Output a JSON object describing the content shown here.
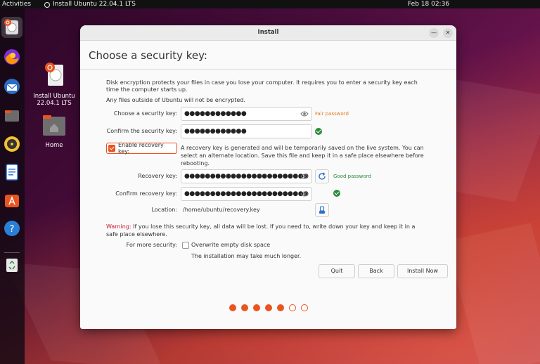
{
  "topbar": {
    "activities": "Activities",
    "app_name": "Install Ubuntu 22.04.1 LTS",
    "clock": "Feb 18  02:36"
  },
  "dock": {
    "items": [
      "ubuntu-installer-icon",
      "firefox-icon",
      "thunderbird-icon",
      "files-icon",
      "rhythmbox-icon",
      "writer-icon",
      "app-center-icon",
      "help-icon",
      "trash-icon"
    ]
  },
  "desktop": {
    "installer_label": "Install Ubuntu 22.04.1 LTS",
    "home_label": "Home"
  },
  "window": {
    "title": "Install",
    "heading": "Choose a security key:",
    "intro_line1": "Disk encryption protects your files in case you lose your computer. It requires you to enter a security key each",
    "intro_line2": "time the computer starts up.",
    "intro_line3": "Any files outside of Ubuntu will not be encrypted.",
    "security_key": {
      "label": "Choose a security key:",
      "value": "●●●●●●●●●●●●",
      "strength": "Fair password"
    },
    "confirm_key": {
      "label": "Confirm the security key:",
      "value": "●●●●●●●●●●●●"
    },
    "recovery_checkbox": {
      "label": "Enable recovery key:",
      "checked": true,
      "desc_line1": "A recovery key is generated and will be temporarily saved on the live system. You can",
      "desc_line2": "select an alternate location. Save this file and keep it in a safe place elsewhere before",
      "desc_line3": "rebooting."
    },
    "recovery_key": {
      "label": "Recovery key:",
      "value": "●●●●●●●●●●●●●●●●●●●●●●●●",
      "strength": "Good password"
    },
    "confirm_recovery": {
      "label": "Confirm recovery key:",
      "value": "●●●●●●●●●●●●●●●●●●●●●●●●"
    },
    "location": {
      "label": "Location:",
      "value": "/home/ubuntu/recovery.key"
    },
    "warning": {
      "prefix": "Warning:",
      "line1": " If you lose this security key, all data will be lost. If you need to, write down your key and keep it in a",
      "line2": "safe place elsewhere."
    },
    "more_security": {
      "label": "For more security:",
      "checkbox_label": "Overwrite empty disk space",
      "note": "The installation may take much longer."
    },
    "buttons": {
      "quit": "Quit",
      "back": "Back",
      "install": "Install Now"
    },
    "progress": {
      "total": 7,
      "completed": 5
    }
  },
  "colors": {
    "accent": "#e95420",
    "success": "#2e8b3e",
    "fair": "#e07a1f",
    "warning": "#c7162b"
  }
}
